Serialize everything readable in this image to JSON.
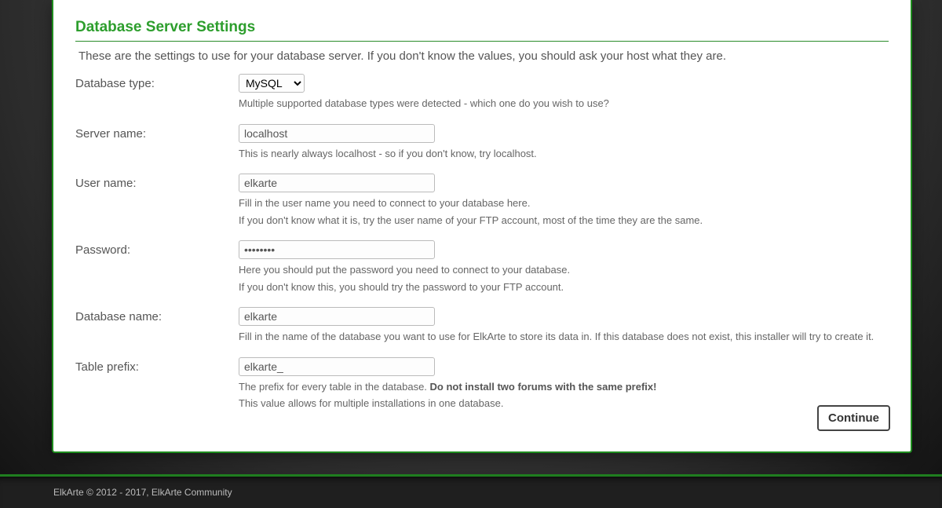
{
  "heading": "Database Server Settings",
  "intro": "These are the settings to use for your database server. If you don't know the values, you should ask your host what they are.",
  "fields": {
    "dbtype": {
      "label": "Database type:",
      "value": "MySQL",
      "hint1": "Multiple supported database types were detected - which one do you wish to use?"
    },
    "server": {
      "label": "Server name:",
      "value": "localhost",
      "hint1": "This is nearly always localhost - so if you don't know, try localhost."
    },
    "user": {
      "label": "User name:",
      "value": "elkarte",
      "hint1": "Fill in the user name you need to connect to your database here.",
      "hint2": "If you don't know what it is, try the user name of your FTP account, most of the time they are the same."
    },
    "password": {
      "label": "Password:",
      "value": "********",
      "hint1": "Here you should put the password you need to connect to your database.",
      "hint2": "If you don't know this, you should try the password to your FTP account."
    },
    "dbname": {
      "label": "Database name:",
      "value": "elkarte",
      "hint1": "Fill in the name of the database you want to use for ElkArte to store its data in. If this database does not exist, this installer will try to create it."
    },
    "prefix": {
      "label": "Table prefix:",
      "value": "elkarte_",
      "hint1_pre": "The prefix for every table in the database. ",
      "hint1_strong": "Do not install two forums with the same prefix!",
      "hint2": "This value allows for multiple installations in one database."
    }
  },
  "continue_label": "Continue",
  "footer": "ElkArte © 2012 - 2017, ElkArte Community"
}
